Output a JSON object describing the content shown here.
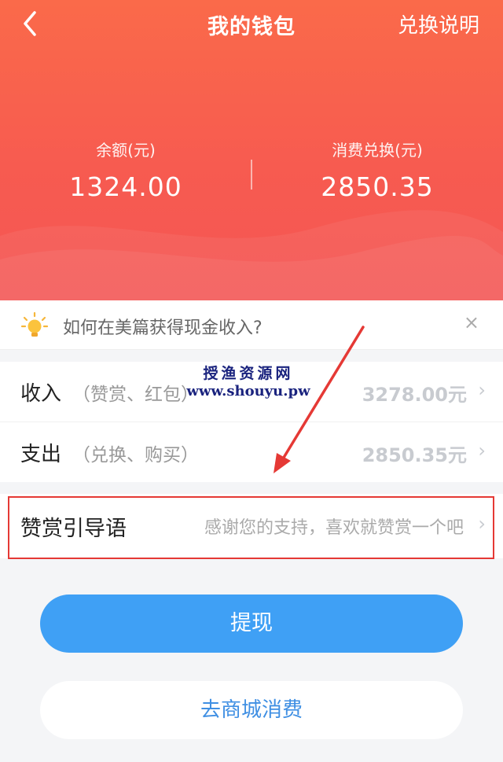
{
  "header": {
    "title": "我的钱包",
    "help_link": "兑换说明",
    "back_icon": "chevron-left-icon"
  },
  "stats": {
    "balance_label": "余额(元)",
    "balance_value": "1324.00",
    "redeem_label": "消费兑换(元)",
    "redeem_value": "2850.35"
  },
  "tip": {
    "icon": "lightbulb-icon",
    "text": "如何在美篇获得现金收入?",
    "close": "×"
  },
  "income": {
    "label": "收入",
    "sub": "（赞赏、红包）",
    "amount": "3278.00元",
    "chevron": "›"
  },
  "expense": {
    "label": "支出",
    "sub": "（兑换、购买）",
    "amount": "2850.35元",
    "chevron": "›"
  },
  "guide": {
    "label": "赞赏引导语",
    "hint": "感谢您的支持，喜欢就赞赏一个吧",
    "chevron": "›"
  },
  "watermark": {
    "line1": "授渔资源网",
    "line2": "www.shouyu.pw"
  },
  "buttons": {
    "withdraw": "提现",
    "mall": "去商城消费"
  },
  "colors": {
    "header_top": "#fa6a4a",
    "header_bottom": "#f45654",
    "primary_blue": "#3fa0f5",
    "highlight_red": "#e53935"
  }
}
